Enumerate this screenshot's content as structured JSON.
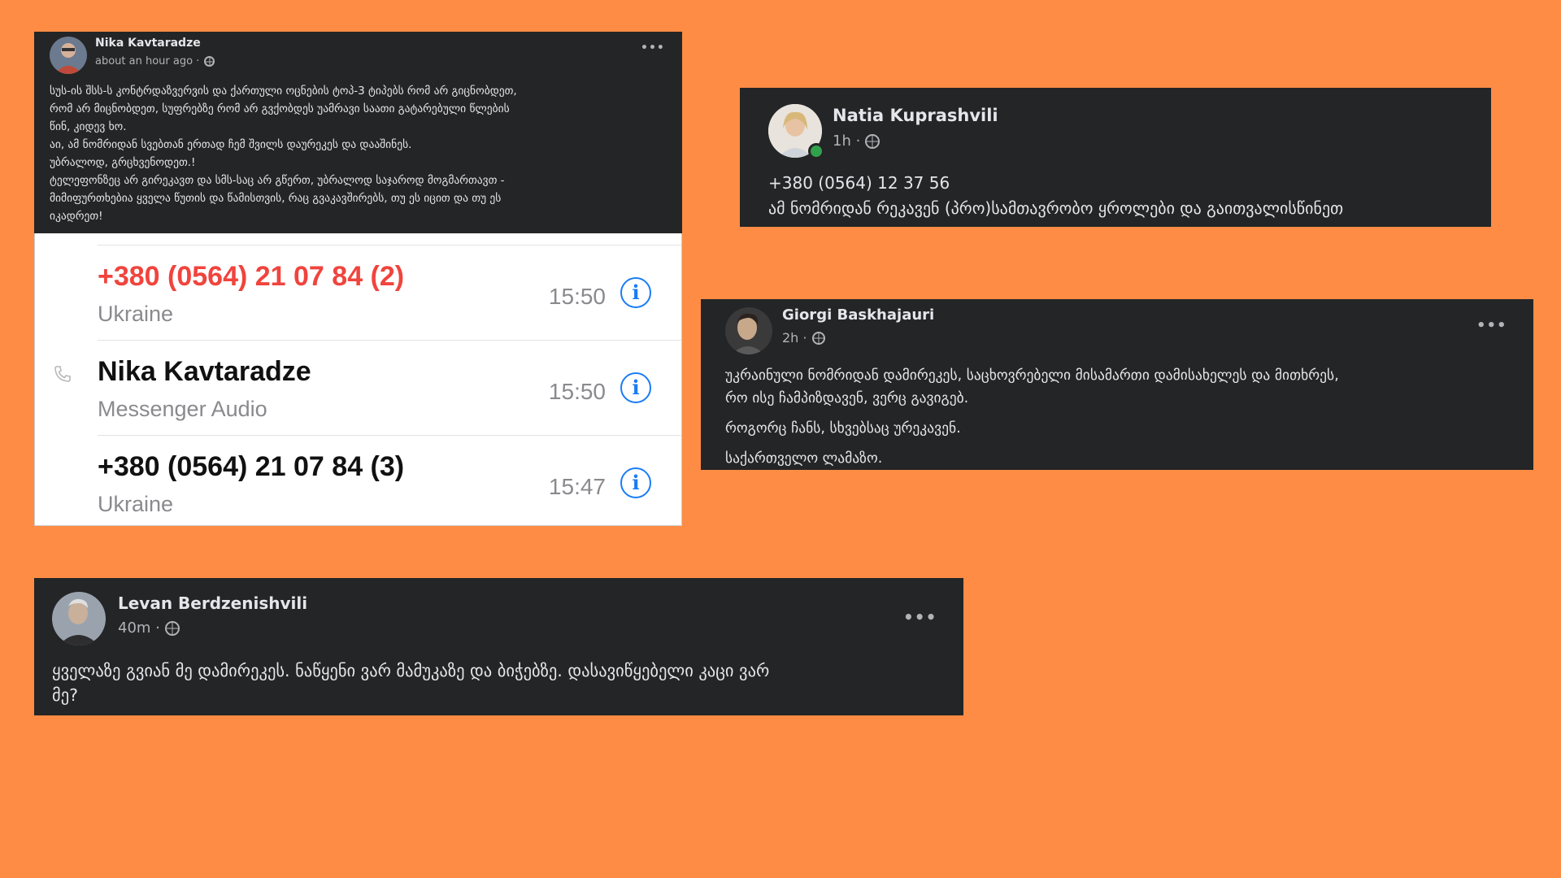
{
  "posts": {
    "nika": {
      "name": "Nika Kavtaradze",
      "meta": "about an hour ago ·",
      "lines": [
        "სუს-ის შსს-ს კონტრდაზვერვის და ქართული ოცნების ტოპ-3 ტიპებს რომ არ გიცნობდეთ,",
        "რომ არ მიცნობდეთ, სუფრებზე რომ არ გვქობდეს უამრავი საათი გატარებული წლების",
        "წინ, კიდევ ხო.",
        "აი, ამ ნომრიდან სვებთან ერთად ჩემ შვილს დაურეკეს და დააშინეს.",
        "უბრალოდ, გრცხვენოდეთ.!",
        "ტელეფონზეც არ გირეკავთ და სმს-საც არ გწერთ, უბრალოდ საჯაროდ მოგმართავთ -",
        "მიმიფურთხებია ყველა წუთის და წამისთვის, რაც გვაკავშირებს, თუ ეს იცით და თუ ეს",
        "იკადრეთ!"
      ],
      "more": "•••"
    },
    "natia": {
      "name": "Natia Kuprashvili",
      "meta": "1h ·",
      "lines": [
        "+380 (0564) 12 37 56",
        "ამ ნომრიდან რეკავენ (პრო)სამთავრობო ყროლები  და გაითვალისწინეთ"
      ]
    },
    "giorgi": {
      "name": "Giorgi Baskhajauri",
      "meta": "2h ·",
      "lines": [
        "უკრაინული ნომრიდან დამირეკეს, საცხოვრებელი მისამართი დამისახელეს და მითხრეს,",
        "რო ისე ჩამპიზდავენ, ვერც გავიგებ."
      ],
      "para2": "როგორც ჩანს, სხვებსაც ურეკავენ.",
      "para3": "საქართველო ლამაზო.",
      "more": "•••"
    },
    "levan": {
      "name": "Levan Berdzenishvili",
      "meta": "40m ·",
      "lines": [
        "ყველაზე გვიან მე დამირეკეს. ნაწყენი ვარ მამუკაზე და ბიჭებზე. დასავიწყებელი კაცი ვარ",
        "მე?"
      ],
      "more": "•••"
    }
  },
  "call_log": {
    "rows": [
      {
        "title": "+380 (0564) 21 07 84 (2)",
        "subtitle": "Ukraine",
        "time": "15:50",
        "missed": true
      },
      {
        "title": "Nika Kavtaradze",
        "subtitle": "Messenger Audio",
        "time": "15:50",
        "missed": false
      },
      {
        "title": "+380 (0564) 21 07 84 (3)",
        "subtitle": "Ukraine",
        "time": "15:47",
        "missed": false
      }
    ],
    "info_icon": "info-icon",
    "accent": "#1a7cf5",
    "missed_color": "#f0443d"
  },
  "colors": {
    "background": "#ff8c45",
    "card": "#242526",
    "online": "#31a24c"
  }
}
